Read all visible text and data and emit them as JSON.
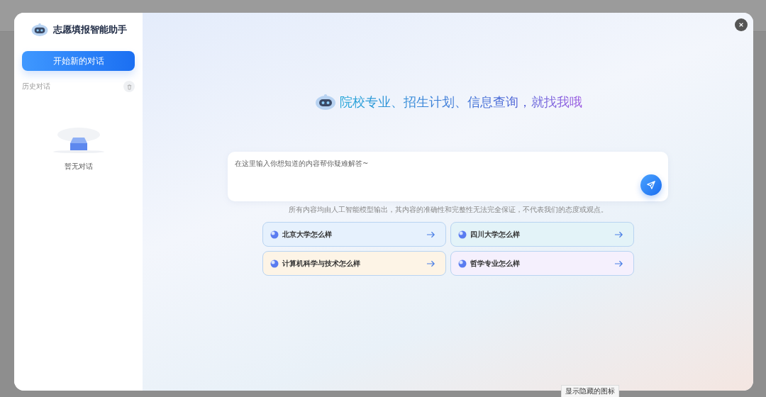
{
  "sidebar": {
    "title": "志愿填报智能助手",
    "new_chat_button": "开始新的对话",
    "history_label": "历史对话",
    "empty_text": "暂无对话"
  },
  "main": {
    "headline": "院校专业、招生计划、信息查询，就找我哦",
    "input": {
      "placeholder": "在这里输入你想知道的内容帮你疑难解答~"
    },
    "disclaimer": "所有内容均由人工智能模型输出，其内容的准确性和完整性无法完全保证，不代表我们的态度或观点。",
    "suggestions": [
      {
        "text": "北京大学怎么样",
        "color": "#e6f1fd"
      },
      {
        "text": "四川大学怎么样",
        "color": "#e3f3f8"
      },
      {
        "text": "计算机科学与技术怎么样",
        "color": "#fdf4e6"
      },
      {
        "text": "哲学专业怎么样",
        "color": "#f5f0fd"
      }
    ]
  },
  "tooltip": "显示隐藏的图标"
}
